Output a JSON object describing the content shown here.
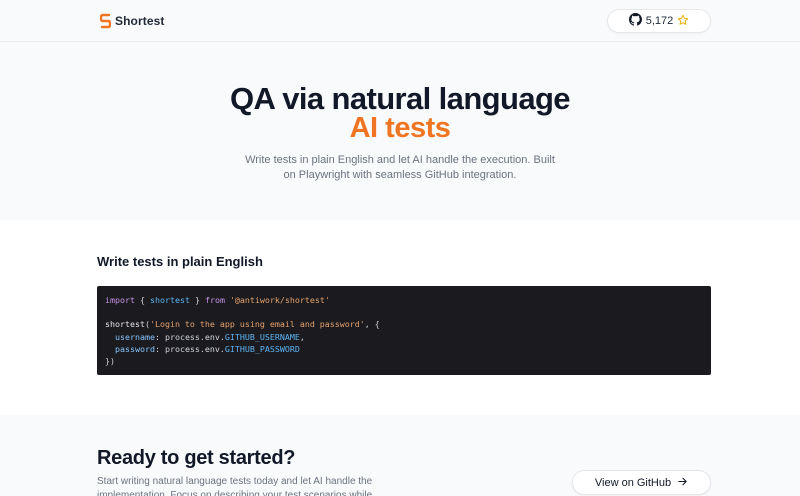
{
  "header": {
    "brand_name": "Shortest",
    "brand_color": "#f07522",
    "github_stars": "5,172",
    "icons": [
      "shortest-logo-icon",
      "github-icon",
      "star-icon"
    ]
  },
  "hero": {
    "title": "QA via natural language",
    "accent": "AI tests",
    "accent_color": "#f07522",
    "description": "Write tests in plain English and let AI handle the execution. Built on Playwright with seamless GitHub integration."
  },
  "example": {
    "heading": "Write tests in plain English",
    "code": {
      "line1": {
        "kw1": "import",
        "p1": " { ",
        "name": "shortest",
        "p2": " } ",
        "kw2": "from",
        "p3": " ",
        "module": "'@antiwork/shortest'"
      },
      "line3": {
        "fn": "shortest",
        "p1": "(",
        "str": "'Login to the app using email and password'",
        "p2": ", {"
      },
      "line4": {
        "indent": "  ",
        "prop": "username",
        "p1": ": process.env.",
        "env": "GITHUB_USERNAME",
        "p2": ","
      },
      "line5": {
        "indent": "  ",
        "prop": "password",
        "p1": ": process.env.",
        "env": "GITHUB_PASSWORD"
      },
      "line6": "})"
    }
  },
  "cta": {
    "title": "Ready to get started?",
    "description": "Start writing natural language tests today and let AI handle the implementation. Focus on describing your test scenarios while Shortest",
    "button_label": "View on GitHub",
    "icons": [
      "arrow-right-icon"
    ]
  }
}
